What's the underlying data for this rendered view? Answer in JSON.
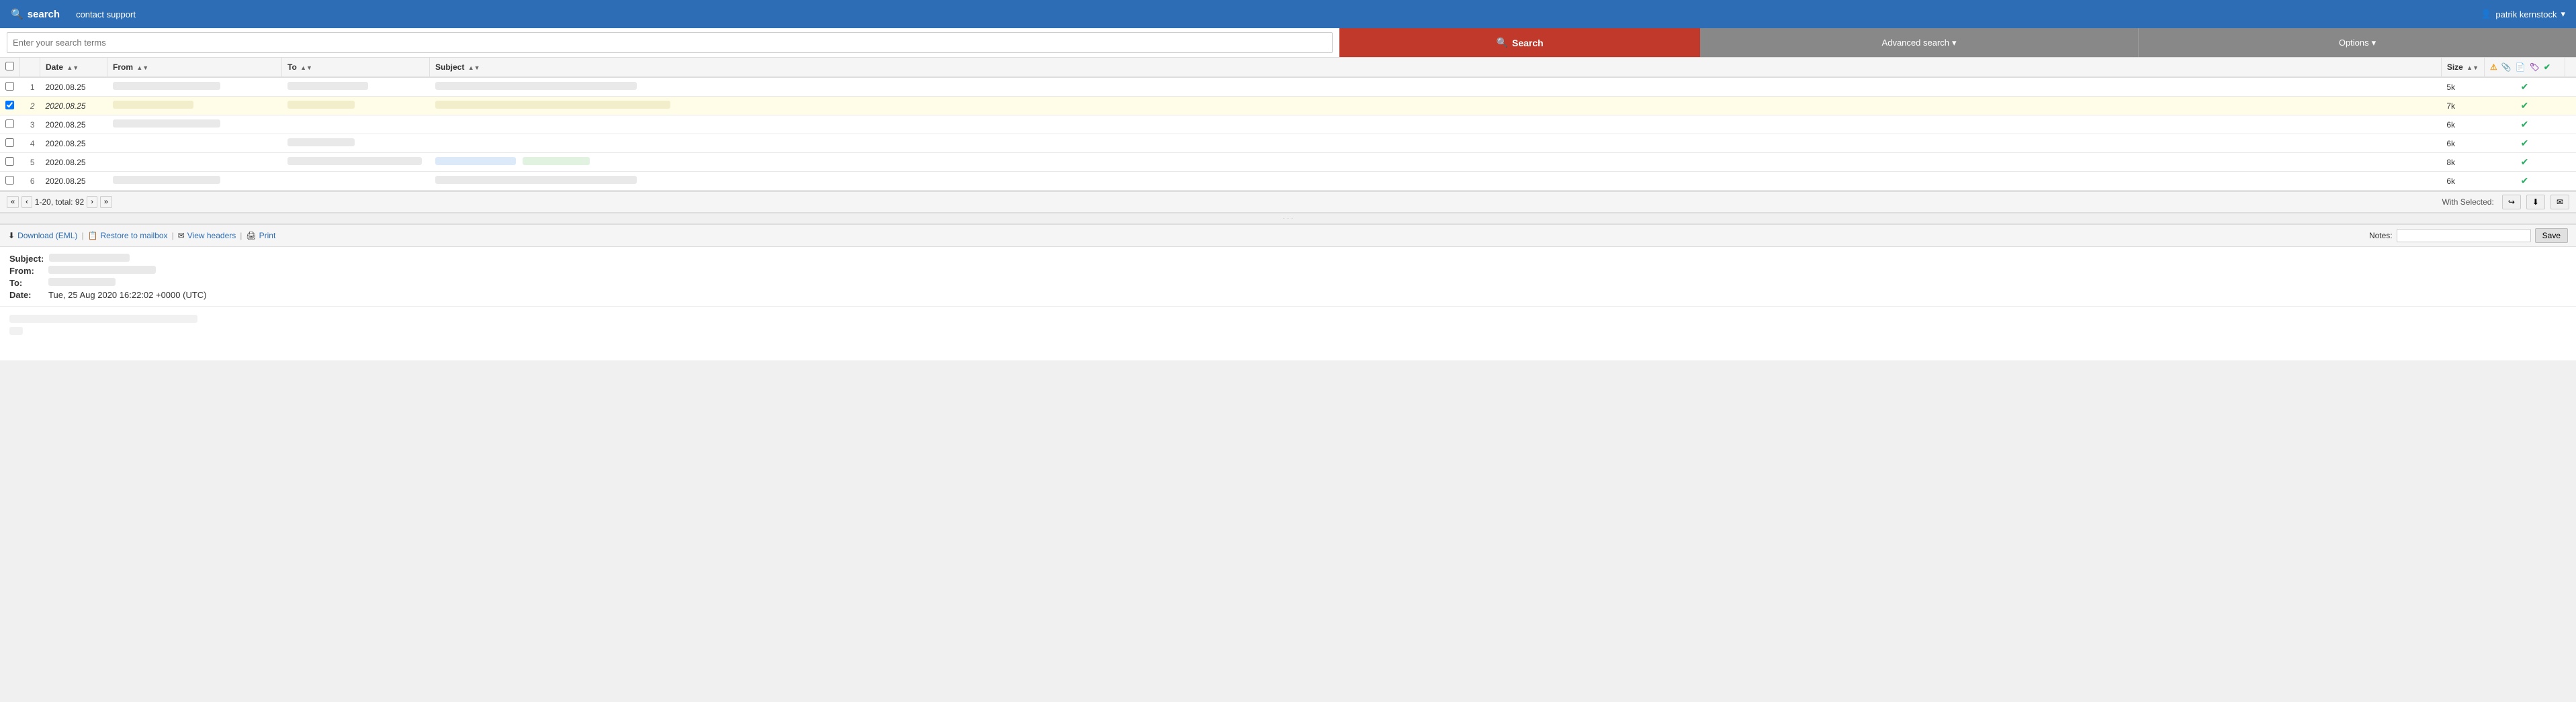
{
  "topnav": {
    "brand": "search",
    "brand_icon": "🔍",
    "contact_support": "contact support",
    "user_icon": "👤",
    "username": "patrik kernstock",
    "user_arrow": "▾"
  },
  "searchbar": {
    "input_placeholder": "Enter your search terms",
    "search_button": "Search",
    "search_icon": "🔍",
    "advanced_search": "Advanced search",
    "advanced_arrow": "▾",
    "options": "Options",
    "options_arrow": "▾"
  },
  "table": {
    "columns": {
      "checkbox": "",
      "num": "",
      "date": "Date",
      "from": "From",
      "to": "To",
      "subject": "Subject",
      "size": "Size",
      "status": ""
    },
    "sort_asc": "▲",
    "sort_desc": "▼",
    "rows": [
      {
        "num": 1,
        "date": "2020.08.25",
        "size": "5k",
        "selected": false
      },
      {
        "num": 2,
        "date": "2020.08.25",
        "size": "7k",
        "selected": true
      },
      {
        "num": 3,
        "date": "2020.08.25",
        "size": "6k",
        "selected": false
      },
      {
        "num": 4,
        "date": "2020.08.25",
        "size": "6k",
        "selected": false
      },
      {
        "num": 5,
        "date": "2020.08.25",
        "size": "8k",
        "selected": false
      },
      {
        "num": 6,
        "date": "2020.08.25",
        "size": "6k",
        "selected": false
      }
    ]
  },
  "pagination": {
    "first": "«",
    "prev": "‹",
    "info": "1-20, total: 92",
    "next": "›",
    "next2": "»",
    "with_selected": "With Selected:",
    "forward_btn": "↪",
    "download_btn": "⬇"
  },
  "preview": {
    "download_eml": "Download (EML)",
    "restore": "Restore to mailbox",
    "view_headers": "View headers",
    "print": "Print",
    "notes_label": "Notes:",
    "notes_placeholder": "",
    "save_button": "Save",
    "subject_label": "Subject:",
    "from_label": "From:",
    "to_label": "To:",
    "date_label": "Date:",
    "date_value": "Tue, 25 Aug 2020 16:22:02 +0000 (UTC)"
  }
}
